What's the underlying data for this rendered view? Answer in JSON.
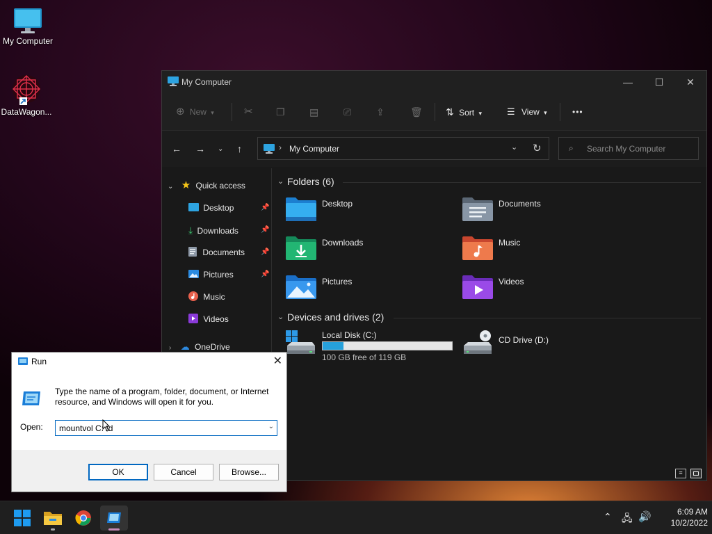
{
  "desktop": {
    "icons": [
      {
        "label": "My Computer",
        "icon": "monitor-icon"
      },
      {
        "label": "DataWagon...",
        "icon": "datawagon-logo-icon"
      }
    ]
  },
  "explorer": {
    "title": "My Computer",
    "toolbar": {
      "new_label": "New",
      "sort_label": "Sort",
      "view_label": "View",
      "more_label": "•••"
    },
    "address": "My Computer",
    "search_placeholder": "Search My Computer",
    "sidebar": {
      "quick_access": "Quick access",
      "items": [
        {
          "label": "Desktop",
          "pinned": true
        },
        {
          "label": "Downloads",
          "pinned": true
        },
        {
          "label": "Documents",
          "pinned": true
        },
        {
          "label": "Pictures",
          "pinned": true
        },
        {
          "label": "Music",
          "pinned": false
        },
        {
          "label": "Videos",
          "pinned": false
        }
      ],
      "onedrive": "OneDrive"
    },
    "folders_header": "Folders (6)",
    "folders": [
      "Desktop",
      "Documents",
      "Downloads",
      "Music",
      "Pictures",
      "Videos"
    ],
    "drives_header": "Devices and drives (2)",
    "drives": [
      {
        "name": "Local Disk (C:)",
        "free": "100 GB free of 119 GB",
        "used_fraction": 0.16
      },
      {
        "name": "CD Drive (D:)"
      }
    ]
  },
  "run": {
    "title": "Run",
    "description": "Type the name of a program, folder, document, or Internet resource, and Windows will open it for you.",
    "open_label": "Open:",
    "input_value": "mountvol C: /d",
    "ok": "OK",
    "cancel": "Cancel",
    "browse": "Browse..."
  },
  "taskbar": {
    "time": "6:09 AM",
    "date": "10/2/2022"
  },
  "colors": {
    "accent": "#0078d4",
    "explorer_bg": "#191919",
    "drive_bar": "#26a0da"
  }
}
